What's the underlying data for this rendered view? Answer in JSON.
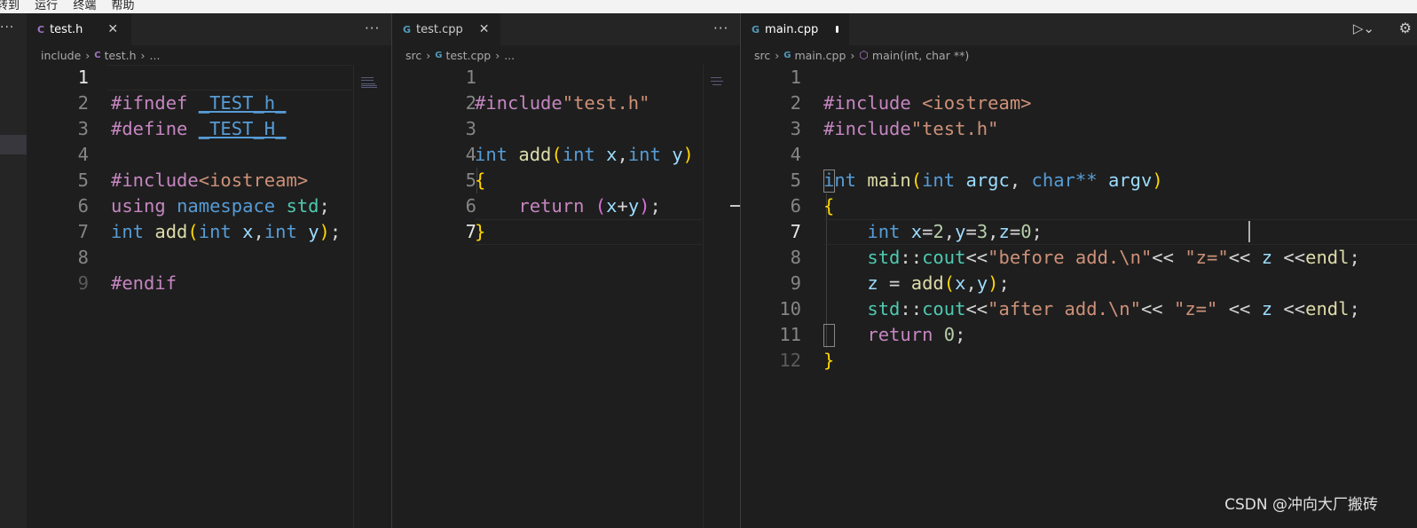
{
  "menubar": {
    "items": [
      "转到",
      "运行",
      "终端",
      "帮助"
    ]
  },
  "colors": {
    "keyword": "#c586c0",
    "type": "#569cd6",
    "function": "#dcdcaa",
    "string": "#ce9178",
    "variable": "#9cdcfe",
    "namespace": "#4ec9b0",
    "number": "#b5cea8",
    "c_icon": "#a074c4",
    "cpp_icon": "#519aba"
  },
  "activity_bar": {
    "more_icon": "ellipsis-icon"
  },
  "editors": [
    {
      "tab": {
        "icon": "C",
        "label": "test.h",
        "close_icon": "close-icon"
      },
      "breadcrumb": {
        "parts": [
          "include",
          "test.h",
          "..."
        ]
      },
      "lines": [
        {
          "num": "1",
          "current": true
        },
        {
          "num": "2"
        },
        {
          "num": "3"
        },
        {
          "num": "4"
        },
        {
          "num": "5"
        },
        {
          "num": "6"
        },
        {
          "num": "7"
        },
        {
          "num": "8"
        },
        {
          "num": "9"
        }
      ]
    },
    {
      "tab": {
        "icon": "G",
        "label": "test.cpp",
        "close_icon": "close-icon"
      },
      "breadcrumb": {
        "parts": [
          "src",
          "test.cpp",
          "..."
        ]
      },
      "lines": [
        {
          "num": "1"
        },
        {
          "num": "2"
        },
        {
          "num": "3"
        },
        {
          "num": "4"
        },
        {
          "num": "5"
        },
        {
          "num": "6"
        },
        {
          "num": "7"
        }
      ]
    },
    {
      "tab": {
        "icon": "G",
        "label": "main.cpp",
        "modified_icon": "unsaved-dot-icon"
      },
      "breadcrumb": {
        "parts": [
          "src",
          "main.cpp",
          "main(int, char **)"
        ]
      },
      "lines": [
        {
          "num": "1"
        },
        {
          "num": "2"
        },
        {
          "num": "3"
        },
        {
          "num": "4"
        },
        {
          "num": "5"
        },
        {
          "num": "6"
        },
        {
          "num": "7",
          "current": true
        },
        {
          "num": "8"
        },
        {
          "num": "9"
        },
        {
          "num": "10"
        },
        {
          "num": "11"
        },
        {
          "num": "12"
        }
      ]
    }
  ],
  "code": {
    "g1": [
      [
        "#ifndef",
        " ",
        "_TEST_h_"
      ],
      [
        "#define",
        " ",
        "_TEST_H_"
      ],
      [],
      [
        "#include",
        "<iostream>"
      ],
      [
        "using",
        " ",
        "namespace",
        " ",
        "std",
        ";"
      ],
      [
        "int",
        " ",
        "add",
        "(",
        "int",
        " ",
        "x",
        ",",
        "int",
        " ",
        "y",
        ")",
        ";"
      ],
      [],
      [
        "#endif"
      ],
      []
    ],
    "g2": [
      [
        "#include",
        "\"test.h\""
      ],
      [],
      [
        "int",
        " ",
        "add",
        "(",
        "int",
        " ",
        "x",
        ",",
        "int",
        " ",
        "y",
        ")"
      ],
      [
        "{"
      ],
      [
        "    ",
        "return",
        " ",
        "(",
        "x",
        "+",
        "y",
        ")",
        ";"
      ],
      [
        "}"
      ],
      []
    ],
    "g3": [
      [
        "#include",
        " ",
        "<iostream>"
      ],
      [
        "#include",
        "\"test.h\""
      ],
      [],
      [
        "int",
        " ",
        "main",
        "(",
        "int",
        " ",
        "argc",
        ", ",
        "char**",
        " ",
        "argv",
        ")"
      ],
      [
        "{"
      ],
      [
        "    ",
        "int",
        " ",
        "x",
        "=",
        "2",
        ",",
        "y",
        "=",
        "3",
        ",",
        "z",
        "=",
        "0",
        ";"
      ],
      [
        "    ",
        "std",
        "::",
        "cout",
        "<<",
        "\"before add.\\n\"",
        "<< ",
        "\"z=\"",
        "<< ",
        "z",
        " <<",
        "endl",
        ";"
      ],
      [
        "    ",
        "z",
        " = ",
        "add",
        "(",
        "x",
        ",",
        "y",
        ")",
        ";"
      ],
      [
        "    ",
        "std",
        "::",
        "cout",
        "<<",
        "\"after add.\\n\"",
        "<< ",
        "\"z=\"",
        " << ",
        "z",
        " <<",
        "endl",
        ";"
      ],
      [
        "    ",
        "return",
        " ",
        "0",
        ";"
      ],
      [
        "}"
      ],
      []
    ]
  },
  "toolbar": {
    "run_icon": "run-debug-icon",
    "settings_icon": "gear-icon"
  },
  "watermark": "CSDN @冲向大厂搬砖"
}
